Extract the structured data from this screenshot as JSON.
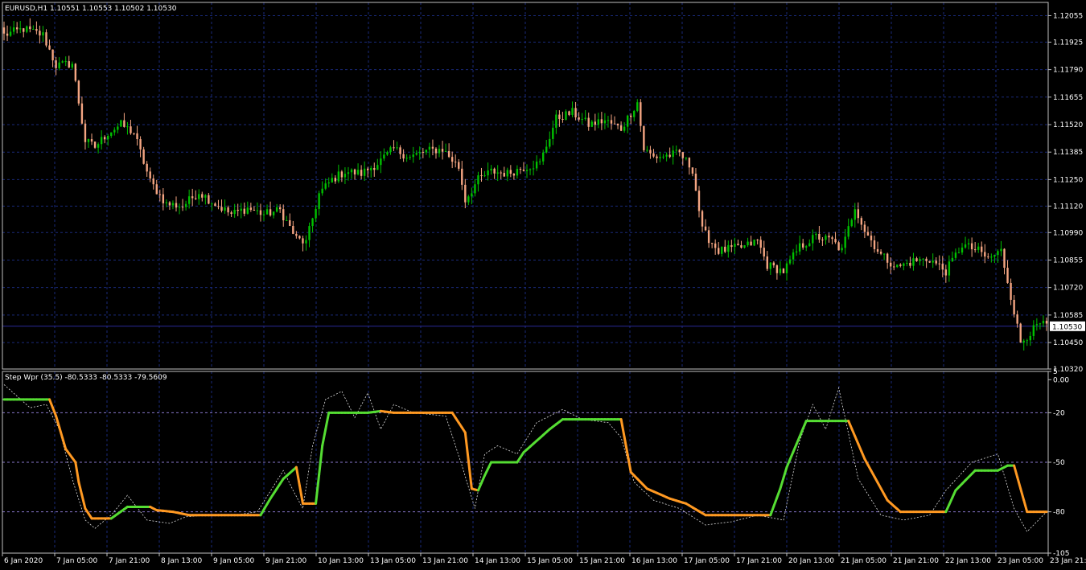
{
  "main_header": "EURUSD,H1  1.10551 1.10553 1.10502 1.10530",
  "indicator_header": "Step Wpr (35.5) -80.5333 -80.5333 -79.5609",
  "colors": {
    "background": "#000000",
    "bull": "#00c000",
    "bear": "#f4a582",
    "grid": "#1a2a7a",
    "frame": "#c0c0c0",
    "line_up": "#55dd33",
    "line_down": "#ff9922",
    "level_line": "#8877cc",
    "price_line": "#2a2a99"
  },
  "chart_data": [
    {
      "type": "candlestick",
      "symbol": "EURUSD",
      "timeframe": "H1",
      "ylim": [
        1.1032,
        1.1212
      ],
      "price_ticks": [
        "1.12055",
        "1.11925",
        "1.11790",
        "1.11655",
        "1.11520",
        "1.11385",
        "1.11250",
        "1.11120",
        "1.10990",
        "1.10855",
        "1.10720",
        "1.10585",
        "1.10450",
        "1.10320"
      ],
      "current_price": "1.10530",
      "time_ticks": [
        "6 Jan 2020",
        "7 Jan 05:00",
        "7 Jan 21:00",
        "8 Jan 13:00",
        "9 Jan 05:00",
        "9 Jan 21:00",
        "10 Jan 13:00",
        "13 Jan 05:00",
        "13 Jan 21:00",
        "14 Jan 13:00",
        "15 Jan 05:00",
        "15 Jan 21:00",
        "16 Jan 13:00",
        "17 Jan 05:00",
        "17 Jan 21:00",
        "20 Jan 13:00",
        "21 Jan 05:00",
        "21 Jan 21:00",
        "22 Jan 13:00",
        "23 Jan 05:00",
        "23 Jan 21:00"
      ],
      "anchors": [
        [
          0,
          1.1196
        ],
        [
          6,
          1.1199
        ],
        [
          12,
          1.1196
        ],
        [
          16,
          1.1181
        ],
        [
          21,
          1.1182
        ],
        [
          25,
          1.1144
        ],
        [
          28,
          1.1141
        ],
        [
          32,
          1.1148
        ],
        [
          36,
          1.1152
        ],
        [
          40,
          1.1148
        ],
        [
          45,
          1.1124
        ],
        [
          50,
          1.1113
        ],
        [
          55,
          1.1112
        ],
        [
          60,
          1.1119
        ],
        [
          65,
          1.1113
        ],
        [
          70,
          1.1108
        ],
        [
          75,
          1.1111
        ],
        [
          80,
          1.1108
        ],
        [
          85,
          1.111
        ],
        [
          90,
          1.1096
        ],
        [
          93,
          1.1094
        ],
        [
          97,
          1.1118
        ],
        [
          101,
          1.1125
        ],
        [
          105,
          1.1129
        ],
        [
          110,
          1.1128
        ],
        [
          115,
          1.1133
        ],
        [
          120,
          1.114
        ],
        [
          125,
          1.1136
        ],
        [
          130,
          1.1139
        ],
        [
          135,
          1.114
        ],
        [
          140,
          1.1131
        ],
        [
          142,
          1.1115
        ],
        [
          146,
          1.1125
        ],
        [
          150,
          1.1129
        ],
        [
          155,
          1.1128
        ],
        [
          160,
          1.1131
        ],
        [
          165,
          1.1133
        ],
        [
          170,
          1.1155
        ],
        [
          175,
          1.1158
        ],
        [
          180,
          1.1152
        ],
        [
          185,
          1.1154
        ],
        [
          190,
          1.115
        ],
        [
          195,
          1.1163
        ],
        [
          197,
          1.114
        ],
        [
          200,
          1.1136
        ],
        [
          205,
          1.1137
        ],
        [
          208,
          1.1138
        ],
        [
          212,
          1.113
        ],
        [
          215,
          1.11
        ],
        [
          220,
          1.109
        ],
        [
          228,
          1.1092
        ],
        [
          232,
          1.1095
        ],
        [
          235,
          1.1083
        ],
        [
          240,
          1.108
        ],
        [
          245,
          1.1092
        ],
        [
          250,
          1.1097
        ],
        [
          255,
          1.1095
        ],
        [
          258,
          1.109
        ],
        [
          262,
          1.1112
        ],
        [
          265,
          1.11
        ],
        [
          270,
          1.1088
        ],
        [
          275,
          1.1082
        ],
        [
          280,
          1.1085
        ],
        [
          285,
          1.1086
        ],
        [
          290,
          1.108
        ],
        [
          295,
          1.1093
        ],
        [
          300,
          1.109
        ],
        [
          303,
          1.1086
        ],
        [
          307,
          1.109
        ],
        [
          310,
          1.1068
        ],
        [
          313,
          1.1045
        ],
        [
          316,
          1.105
        ],
        [
          319,
          1.1054
        ],
        [
          321,
          1.1053
        ]
      ]
    },
    {
      "type": "line",
      "name": "Step Wpr (35.5)",
      "ylim": [
        -105,
        5
      ],
      "ticks": [
        "5",
        "0.00",
        "-20",
        "-50",
        "-80",
        "-105"
      ],
      "levels": [
        -20,
        -50,
        -80
      ],
      "anchors": [
        [
          0,
          -12
        ],
        [
          14,
          -12
        ],
        [
          16,
          -22
        ],
        [
          19,
          -42
        ],
        [
          22,
          -50
        ],
        [
          23,
          -62
        ],
        [
          25,
          -78
        ],
        [
          27,
          -84
        ],
        [
          33,
          -84
        ],
        [
          38,
          -77
        ],
        [
          45,
          -77
        ],
        [
          47,
          -79
        ],
        [
          52,
          -80
        ],
        [
          57,
          -82
        ],
        [
          79,
          -82
        ],
        [
          82,
          -72
        ],
        [
          86,
          -60
        ],
        [
          90,
          -53
        ],
        [
          92,
          -75
        ],
        [
          96,
          -75
        ],
        [
          98,
          -40
        ],
        [
          100,
          -20
        ],
        [
          112,
          -20
        ],
        [
          116,
          -19
        ],
        [
          120,
          -20
        ],
        [
          138,
          -20
        ],
        [
          142,
          -32
        ],
        [
          144,
          -66
        ],
        [
          146,
          -67
        ],
        [
          148,
          -58
        ],
        [
          150,
          -50
        ],
        [
          158,
          -50
        ],
        [
          160,
          -44
        ],
        [
          168,
          -30
        ],
        [
          172,
          -24
        ],
        [
          190,
          -24
        ],
        [
          193,
          -56
        ],
        [
          198,
          -66
        ],
        [
          205,
          -72
        ],
        [
          210,
          -75
        ],
        [
          216,
          -82
        ],
        [
          236,
          -82
        ],
        [
          239,
          -66
        ],
        [
          241,
          -53
        ],
        [
          247,
          -25
        ],
        [
          260,
          -25
        ],
        [
          265,
          -48
        ],
        [
          272,
          -73
        ],
        [
          276,
          -80
        ],
        [
          290,
          -80
        ],
        [
          293,
          -67
        ],
        [
          299,
          -55
        ],
        [
          306,
          -55
        ],
        [
          309,
          -52
        ],
        [
          311,
          -52
        ],
        [
          315,
          -80
        ],
        [
          321,
          -80
        ]
      ],
      "dotted_anchors": [
        [
          0,
          -3
        ],
        [
          8,
          -17
        ],
        [
          13,
          -15
        ],
        [
          17,
          -30
        ],
        [
          21,
          -60
        ],
        [
          25,
          -85
        ],
        [
          28,
          -90
        ],
        [
          33,
          -82
        ],
        [
          38,
          -70
        ],
        [
          44,
          -85
        ],
        [
          51,
          -87
        ],
        [
          56,
          -83
        ],
        [
          63,
          -82
        ],
        [
          71,
          -82
        ],
        [
          78,
          -80
        ],
        [
          86,
          -55
        ],
        [
          89,
          -67
        ],
        [
          92,
          -78
        ],
        [
          95,
          -40
        ],
        [
          99,
          -12
        ],
        [
          104,
          -7
        ],
        [
          108,
          -23
        ],
        [
          112,
          -8
        ],
        [
          116,
          -30
        ],
        [
          120,
          -15
        ],
        [
          126,
          -20
        ],
        [
          136,
          -22
        ],
        [
          141,
          -52
        ],
        [
          145,
          -78
        ],
        [
          148,
          -45
        ],
        [
          152,
          -40
        ],
        [
          158,
          -45
        ],
        [
          164,
          -26
        ],
        [
          172,
          -18
        ],
        [
          178,
          -24
        ],
        [
          186,
          -26
        ],
        [
          190,
          -35
        ],
        [
          194,
          -62
        ],
        [
          200,
          -73
        ],
        [
          208,
          -78
        ],
        [
          216,
          -88
        ],
        [
          224,
          -86
        ],
        [
          232,
          -82
        ],
        [
          240,
          -85
        ],
        [
          245,
          -37
        ],
        [
          249,
          -15
        ],
        [
          253,
          -30
        ],
        [
          257,
          -5
        ],
        [
          263,
          -60
        ],
        [
          270,
          -82
        ],
        [
          277,
          -85
        ],
        [
          285,
          -82
        ],
        [
          290,
          -67
        ],
        [
          298,
          -50
        ],
        [
          306,
          -45
        ],
        [
          311,
          -78
        ],
        [
          315,
          -92
        ],
        [
          321,
          -80
        ]
      ]
    }
  ]
}
